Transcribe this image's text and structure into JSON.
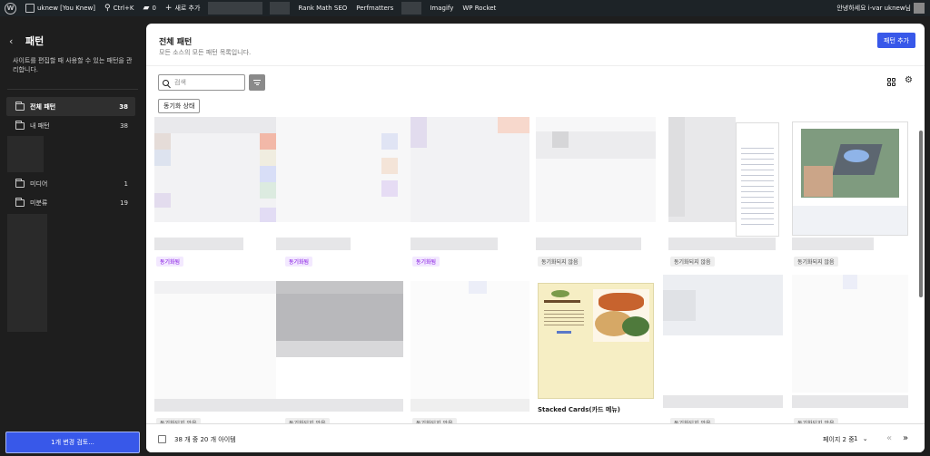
{
  "admin_bar": {
    "site_name": "uknew [You Knew]",
    "search_shortcut": "Ctrl+K",
    "comments_count": "0",
    "new_label": "새로 추가",
    "items": [
      "Rank Math SEO",
      "Perfmatters",
      "Imagify",
      "WP Rocket"
    ],
    "greeting": "안녕하세요 i-var uknew님"
  },
  "sidebar": {
    "title": "패턴",
    "description": "사이트를 편집할 때 사용할 수 있는 패턴을 관리합니다.",
    "items": [
      {
        "label": "전체 패턴",
        "count": "38"
      },
      {
        "label": "내 패턴",
        "count": "38"
      },
      {
        "label": "미디어",
        "count": "1"
      },
      {
        "label": "미분류",
        "count": "19"
      }
    ],
    "footer_button": "1개 변경 검토..."
  },
  "main": {
    "title": "전체 패턴",
    "description": "모든 소스의 모든 패턴 목록입니다.",
    "add_button": "패턴 추가",
    "search_placeholder": "검색",
    "sync_filter_chip": "동기화 상태",
    "badges": {
      "synced": "동기화됨",
      "unsynced": "동기화되지 않음"
    },
    "card_titles": {
      "stacked_cards": "Stacked Cards(카드 메뉴)"
    },
    "footer": {
      "item_count": "38 개 중 20 개 아이템",
      "page_label": "페이지 2 중",
      "page_value": "1"
    }
  },
  "icons": {
    "back": "chevron-left-icon",
    "folder": "folder-icon",
    "search": "search-icon",
    "filter": "filter-icon",
    "grid_view": "grid-view-icon",
    "settings": "gear-icon"
  },
  "colors": {
    "accent": "#3858e9",
    "synced_text": "#7a00df",
    "admin_bar": "#1d2327"
  }
}
